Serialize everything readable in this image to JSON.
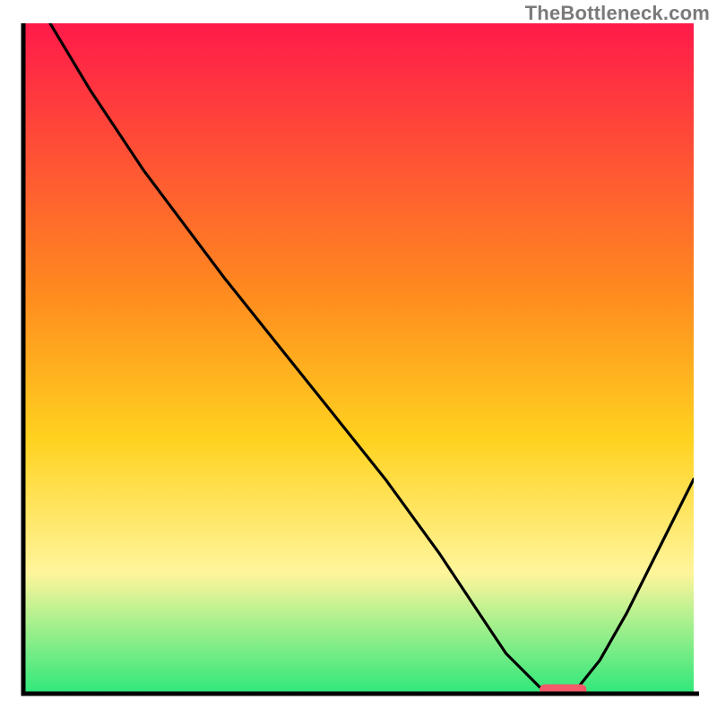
{
  "watermark": "TheBottleneck.com",
  "colors": {
    "gradient_top": "#ff1a4a",
    "gradient_mid1": "#ff8a1f",
    "gradient_mid2": "#ffd21f",
    "gradient_mid3": "#fff59b",
    "gradient_bottom": "#2ee87a",
    "axis": "#000000",
    "curve": "#000000",
    "marker": "#f45a6a"
  },
  "chart_data": {
    "type": "line",
    "title": "",
    "xlabel": "",
    "ylabel": "",
    "xlim": [
      0,
      100
    ],
    "ylim": [
      0,
      100
    ],
    "grid": false,
    "legend": false,
    "series": [
      {
        "name": "bottleneck-curve",
        "x": [
          4,
          10,
          18,
          24,
          30,
          38,
          46,
          54,
          62,
          68,
          72,
          77,
          80,
          82,
          86,
          90,
          94,
          100
        ],
        "y": [
          100,
          90,
          78,
          70,
          62,
          52,
          42,
          32,
          21,
          12,
          6,
          1,
          0,
          0,
          5,
          12,
          20,
          32
        ]
      }
    ],
    "marker": {
      "name": "optimal-range",
      "x_start": 77,
      "x_end": 84,
      "y": 0.6
    }
  }
}
